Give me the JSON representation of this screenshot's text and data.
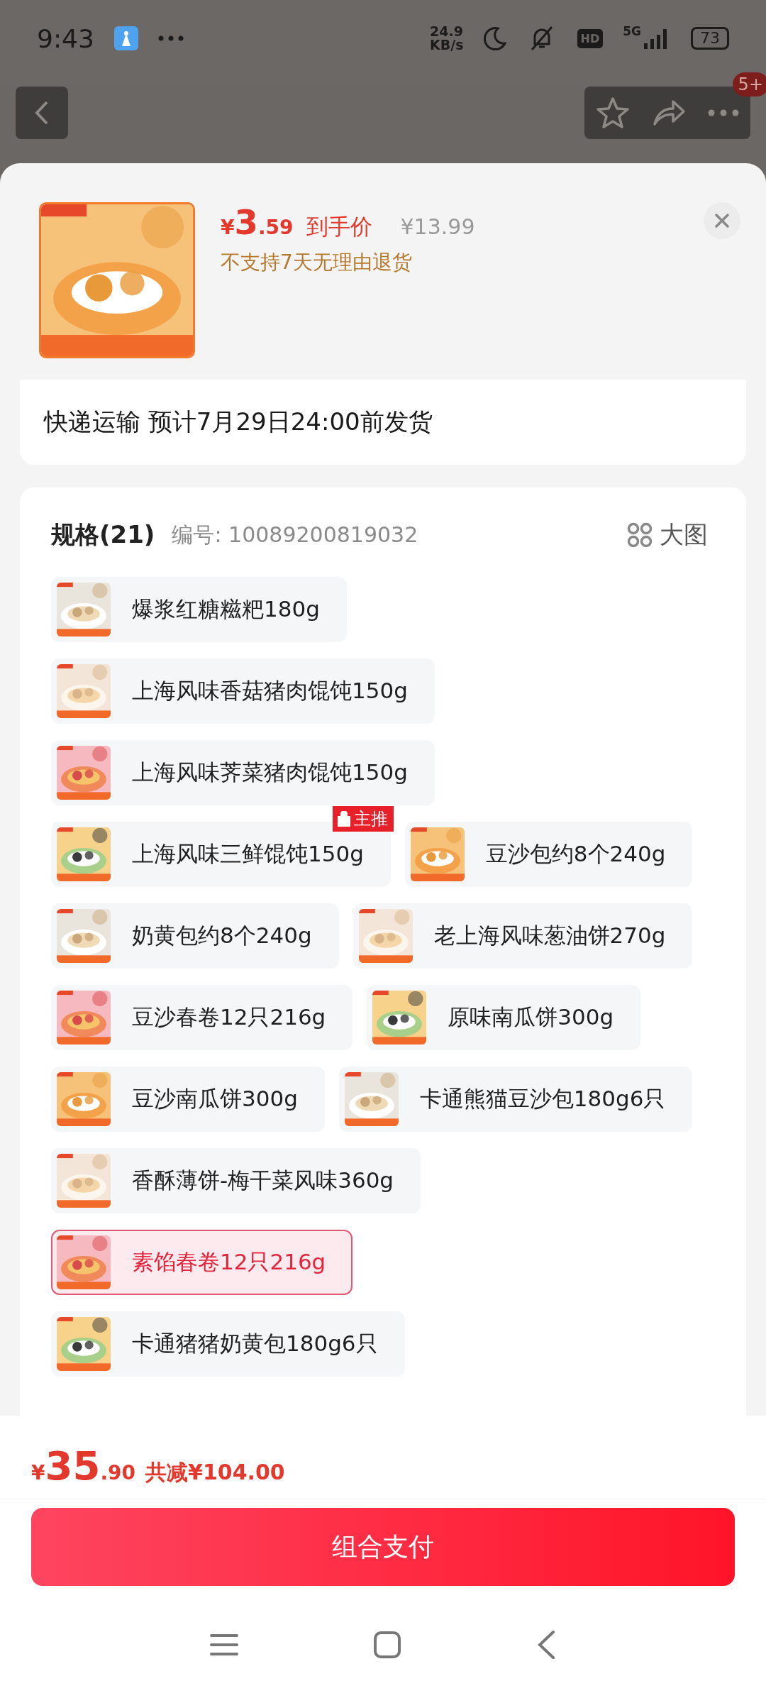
{
  "status_bar": {
    "time": "9:43",
    "net_speed_value": "24.9",
    "net_speed_unit": "KB/s",
    "hd": "HD",
    "network": "5G",
    "battery": "73"
  },
  "top_actions": {
    "badge": "5+"
  },
  "product": {
    "price_symbol": "¥",
    "price_int": "3",
    "price_dec": ".59",
    "price_label": "到手价",
    "original_price": "¥13.99",
    "notice": "不支持7天无理由退货"
  },
  "shipping": "快递运输 预计7月29日24:00前发货",
  "specs": {
    "title": "规格(21)",
    "code": "编号: 10089200819032",
    "view_toggle": "大图",
    "rows": [
      [
        {
          "label": "爆浆红糖糍粑180g",
          "selected": false
        }
      ],
      [
        {
          "label": "上海风味香菇猪肉馄饨150g",
          "selected": false
        }
      ],
      [
        {
          "label": "上海风味荠菜猪肉馄饨150g",
          "selected": false
        }
      ],
      [
        {
          "label": "上海风味三鲜馄饨150g",
          "selected": false,
          "tag": "主推"
        },
        {
          "label": "豆沙包约8个240g",
          "selected": false
        }
      ],
      [
        {
          "label": "奶黄包约8个240g",
          "selected": false
        },
        {
          "label": "老上海风味葱油饼270g",
          "selected": false
        }
      ],
      [
        {
          "label": "豆沙春卷12只216g",
          "selected": false
        },
        {
          "label": "原味南瓜饼300g",
          "selected": false
        }
      ],
      [
        {
          "label": "豆沙南瓜饼300g",
          "selected": false
        },
        {
          "label": "卡通熊猫豆沙包180g6只",
          "selected": false
        }
      ],
      [
        {
          "label": "香酥薄饼-梅干菜风味360g",
          "selected": false
        }
      ],
      [
        {
          "label": "素馅春卷12只216g",
          "selected": true
        }
      ],
      [
        {
          "label": "卡通猪猪奶黄包180g6只",
          "selected": false
        }
      ]
    ]
  },
  "footer": {
    "price_symbol": "¥",
    "price_int": "35",
    "price_dec": ".90",
    "saving": "共减¥104.00",
    "pay_button": "组合支付"
  }
}
